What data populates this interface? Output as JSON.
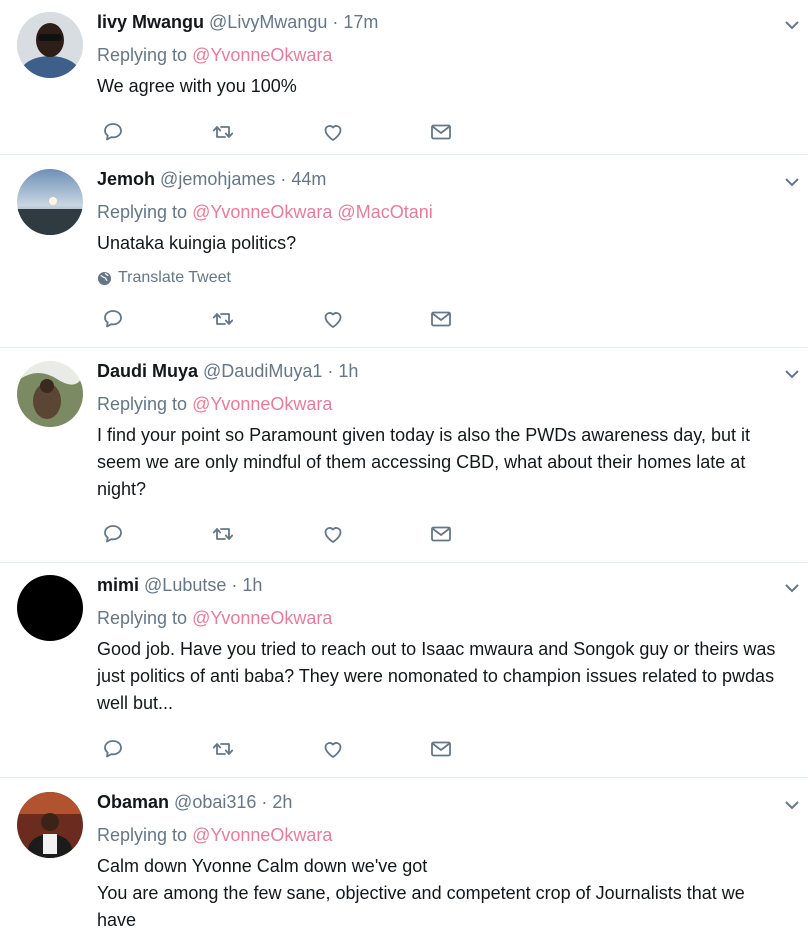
{
  "tweets": [
    {
      "name": "livy Mwangu",
      "handle": "@LivyMwangu",
      "time": "17m",
      "replying_label": "Replying to",
      "mentions": "@YvonneOkwara",
      "text": "We agree with you 100%"
    },
    {
      "name": "Jemoh",
      "handle": "@jemohjames",
      "time": "44m",
      "replying_label": "Replying to",
      "mentions": "@YvonneOkwara @MacOtani",
      "text": "Unataka kuingia politics?",
      "translate": "Translate Tweet"
    },
    {
      "name": "Daudi Muya",
      "handle": "@DaudiMuya1",
      "time": "1h",
      "replying_label": "Replying to",
      "mentions": "@YvonneOkwara",
      "text": "I find your point so Paramount given today is also the PWDs awareness day, but it seem we are only mindful of them accessing CBD, what about their homes late at night?"
    },
    {
      "name": "mimi",
      "handle": "@Lubutse",
      "time": "1h",
      "replying_label": "Replying to",
      "mentions": "@YvonneOkwara",
      "text": "Good job. Have you tried to reach out to Isaac mwaura and Songok guy or theirs was just politics of anti baba? They were nomonated to champion issues related to pwdas well but..."
    },
    {
      "name": "Obaman",
      "handle": "@obai316",
      "time": "2h",
      "replying_label": "Replying to",
      "mentions": "@YvonneOkwara",
      "text": "Calm down Yvonne Calm down we've got\nYou are among the few sane, objective and competent crop of Journalists that we have"
    }
  ],
  "separator": "·",
  "icons": {
    "caret": "chevron-down-icon",
    "reply": "reply-icon",
    "retweet": "retweet-icon",
    "like": "like-icon",
    "dm": "direct-message-icon",
    "globe": "globe-icon"
  },
  "colors": {
    "mention": "#e57d9a",
    "secondary_text": "#657786",
    "divider": "#e6ecf0"
  }
}
